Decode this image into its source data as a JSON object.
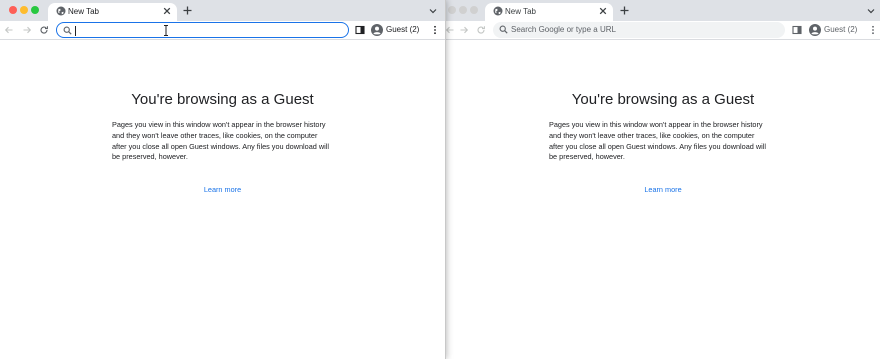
{
  "colors": {
    "accent": "#1a73e8",
    "tabstrip_bg": "#dee1e6",
    "omnibox_bg": "#f1f3f4",
    "traffic_close": "#fe5f57",
    "traffic_minimize": "#febc2e",
    "traffic_maximize": "#28c840",
    "traffic_inactive": "#d0d0d0"
  },
  "left_window": {
    "focused": true,
    "tab": {
      "title": "New Tab",
      "favicon": "globe-icon",
      "close_icon": "close-icon"
    },
    "new_tab_icon": "plus-icon",
    "tab_search_icon": "chevron-down-icon",
    "toolbar": {
      "back_icon": "arrow-left-icon",
      "forward_icon": "arrow-right-icon",
      "reload_icon": "reload-icon",
      "omnibox_value": "",
      "omnibox_icon": "search-icon",
      "side_panel_icon": "side-panel-icon",
      "profile_label": "Guest (2)",
      "profile_icon": "avatar-icon",
      "menu_icon": "kebab-menu-icon"
    },
    "page": {
      "title": "You're browsing as a Guest",
      "body": "Pages you view in this window won't appear in the browser history and they won't leave other traces, like cookies, on the computer after you close all open Guest windows. Any files you download will be preserved, however.",
      "learn_more": "Learn more"
    }
  },
  "right_window": {
    "focused": false,
    "tab": {
      "title": "New Tab",
      "favicon": "globe-icon",
      "close_icon": "close-icon"
    },
    "new_tab_icon": "plus-icon",
    "tab_search_icon": "chevron-down-icon",
    "toolbar": {
      "back_icon": "arrow-left-icon",
      "forward_icon": "arrow-right-icon",
      "reload_icon": "reload-icon",
      "omnibox_placeholder": "Search Google or type a URL",
      "omnibox_icon": "search-icon",
      "side_panel_icon": "side-panel-icon",
      "profile_label": "Guest (2)",
      "profile_icon": "avatar-icon",
      "menu_icon": "kebab-menu-icon"
    },
    "page": {
      "title": "You're browsing as a Guest",
      "body": "Pages you view in this window won't appear in the browser history and they won't leave other traces, like cookies, on the computer after you close all open Guest windows. Any files you download will be preserved, however.",
      "learn_more": "Learn more"
    }
  }
}
